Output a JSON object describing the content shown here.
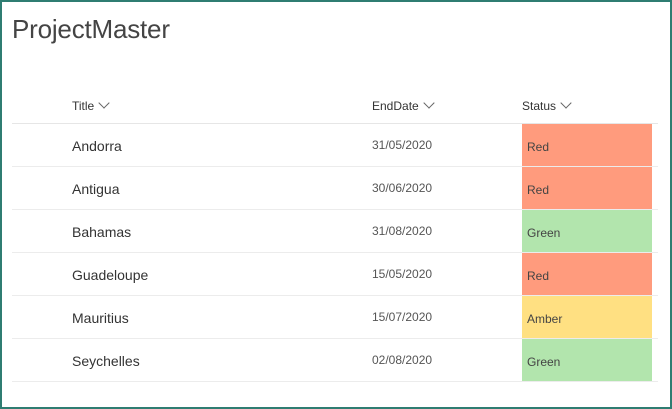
{
  "page": {
    "title": "ProjectMaster"
  },
  "columns": [
    {
      "label": "Title"
    },
    {
      "label": "EndDate"
    },
    {
      "label": "Status"
    }
  ],
  "colors": {
    "Red": "#ff9b7d",
    "Green": "#b2e5ad",
    "Amber": "#ffe082",
    "frame": "#2f7d72"
  },
  "rows": [
    {
      "title": "Andorra",
      "end_date": "31/05/2020",
      "status": "Red"
    },
    {
      "title": "Antigua",
      "end_date": "30/06/2020",
      "status": "Red"
    },
    {
      "title": "Bahamas",
      "end_date": "31/08/2020",
      "status": "Green"
    },
    {
      "title": "Guadeloupe",
      "end_date": "15/05/2020",
      "status": "Red"
    },
    {
      "title": "Mauritius",
      "end_date": "15/07/2020",
      "status": "Amber"
    },
    {
      "title": "Seychelles",
      "end_date": "02/08/2020",
      "status": "Green"
    }
  ]
}
